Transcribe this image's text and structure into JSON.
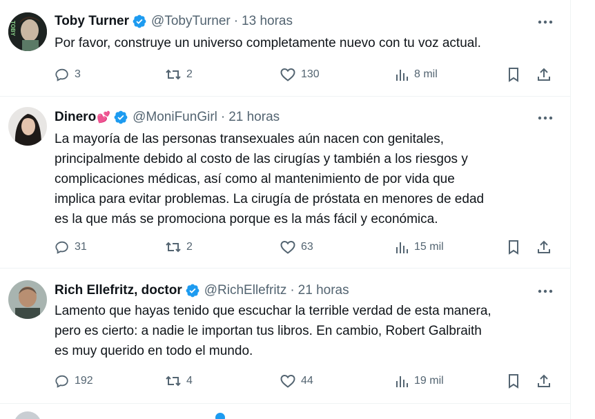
{
  "tweets": [
    {
      "name": "Toby Turner",
      "name_emoji": "",
      "handle": "@TobyTurner",
      "dot": "·",
      "time": "13 horas",
      "text": "Por favor, construye un universo completamente nuevo con tu voz actual.",
      "replies": "3",
      "retweets": "2",
      "likes": "130",
      "views": "8 mil",
      "avatar_text": "TOBY"
    },
    {
      "name": "Dinero",
      "name_emoji": "💕",
      "handle": "@MoniFunGirl",
      "dot": "·",
      "time": "21 horas",
      "text": "La mayoría de las personas transexuales aún nacen con genitales,\nprincipalmente debido al costo de las cirugías y también a los riesgos y\ncomplicaciones médicas, así como al mantenimiento de por vida que\nimplica para evitar problemas. La cirugía de próstata en menores de edad\nes la que más se promociona porque es la más fácil y económica.",
      "replies": "31",
      "retweets": "2",
      "likes": "63",
      "views": "15 mil"
    },
    {
      "name": "Rich Ellefritz, doctor",
      "name_emoji": "",
      "handle": "@RichEllefritz",
      "dot": "·",
      "time": "21 horas",
      "text": "Lamento que hayas tenido que escuchar la terrible verdad de esta manera,\npero es cierto: a nadie le importan tus libros. En cambio, Robert Galbraith\nes muy querido en todo el mundo.",
      "replies": "192",
      "retweets": "4",
      "likes": "44",
      "views": "19 mil"
    }
  ],
  "colors": {
    "verified": "#1d9bf0",
    "muted": "#536471",
    "text": "#0f1419",
    "divider": "#eff3f4"
  },
  "icons": [
    "verified-icon",
    "more-icon",
    "reply-icon",
    "retweet-icon",
    "like-icon",
    "views-icon",
    "bookmark-icon",
    "share-icon"
  ]
}
